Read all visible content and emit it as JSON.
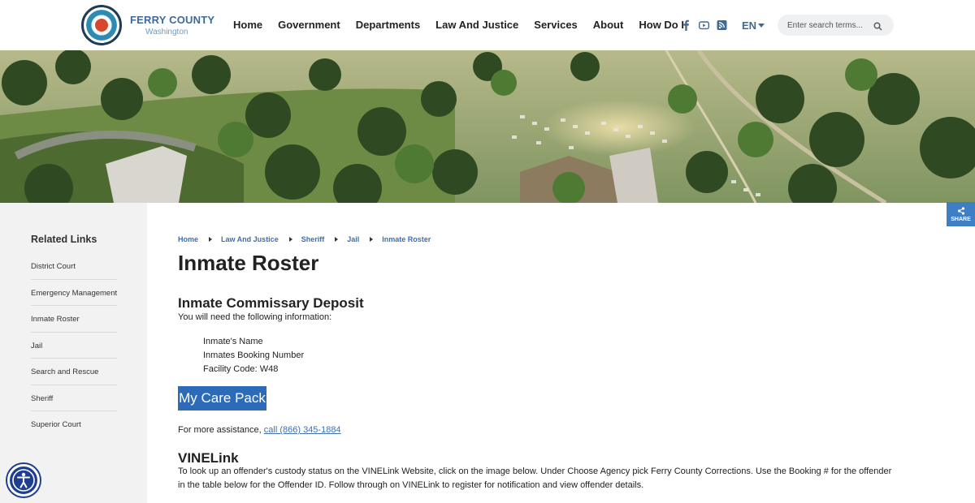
{
  "header": {
    "logo_name": "FERRY COUNTY",
    "logo_sub": "Washington",
    "nav": [
      "Home",
      "Government",
      "Departments",
      "Law And Justice",
      "Services",
      "About",
      "How Do I"
    ],
    "language": "EN",
    "search_placeholder": "Enter search terms...",
    "icons": [
      "facebook-icon",
      "youtube-icon",
      "rss-icon",
      "search-icon"
    ]
  },
  "share": {
    "label": "SHARE"
  },
  "sidebar": {
    "title": "Related Links",
    "items": [
      "District Court",
      "Emergency Management",
      "Inmate Roster",
      "Jail",
      "Search and Rescue",
      "Sheriff",
      "Superior Court"
    ]
  },
  "breadcrumb": [
    "Home",
    "Law And Justice",
    "Sheriff",
    "Jail",
    "Inmate Roster"
  ],
  "main": {
    "title": "Inmate Roster",
    "commissary_heading": "Inmate Commissary Deposit",
    "need_info": "You will need the following information:",
    "bullets": [
      "Inmate's Name",
      "Inmates Booking Number",
      "Facility Code: W48"
    ],
    "care_pack_button": "My Care Pack",
    "assist_text": "For more assistance, ",
    "assist_link": "call (866) 345-1884",
    "vinelink_heading": "VINELink",
    "vinelink_line1": "To look up an offender's custody status on the VINELink Website, click on the image below. Under Choose Agency pick Ferry County Corrections. Use the Booking # for the offender",
    "vinelink_line2": "in the table below for the Offender ID. Follow through on VINELink to register for notification and view offender details."
  },
  "colors": {
    "accent": "#2d6bb8",
    "link": "#3d6fb1",
    "sidebar_bg": "#f2f2f2",
    "share_bg": "#3d7ec4",
    "access_bg": "#1e3f8f"
  }
}
